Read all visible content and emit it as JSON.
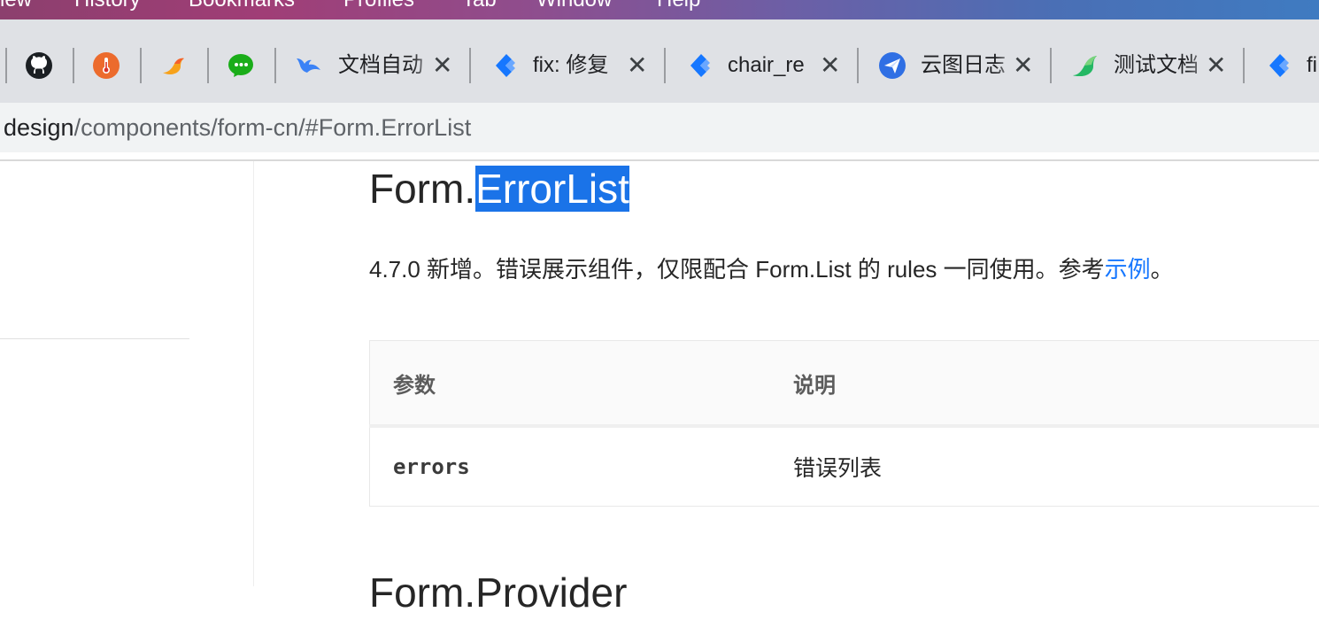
{
  "menubar": {
    "items": [
      "iew",
      "History",
      "Bookmarks",
      "Profiles",
      "Tab",
      "Window",
      "Help"
    ]
  },
  "tabs": [
    {
      "title": "文档自动",
      "icon": "yuque-bird-icon"
    },
    {
      "title": "fix: 修复",
      "icon": "gitlab-cube-icon"
    },
    {
      "title": "chair_re",
      "icon": "gitlab-cube-icon"
    },
    {
      "title": "云图日志",
      "icon": "paper-plane-icon"
    },
    {
      "title": "测试文档",
      "icon": "green-bird-icon"
    },
    {
      "title": "fi",
      "icon": "gitlab-cube-icon"
    }
  ],
  "pinned_tabs": [
    "github-icon",
    "thermometer-icon",
    "bird-icon",
    "wechat-icon"
  ],
  "address": {
    "host": "design",
    "path": "/components/form-cn/#Form.ErrorList"
  },
  "page": {
    "title_prefix": "Form.",
    "title_highlight": "ErrorList",
    "desc_text": "4.7.0 新增。错误展示组件，仅限配合 Form.List 的 rules 一同使用。参考",
    "desc_link": "示例",
    "desc_end": "。",
    "table": {
      "headers": [
        "参数",
        "说明"
      ],
      "rows": [
        {
          "param": "errors",
          "desc": "错误列表"
        }
      ]
    },
    "next_heading": "Form.Provider"
  },
  "colors": {
    "link": "#1677ff",
    "selection": "#1a73e8",
    "text": "#262626"
  }
}
